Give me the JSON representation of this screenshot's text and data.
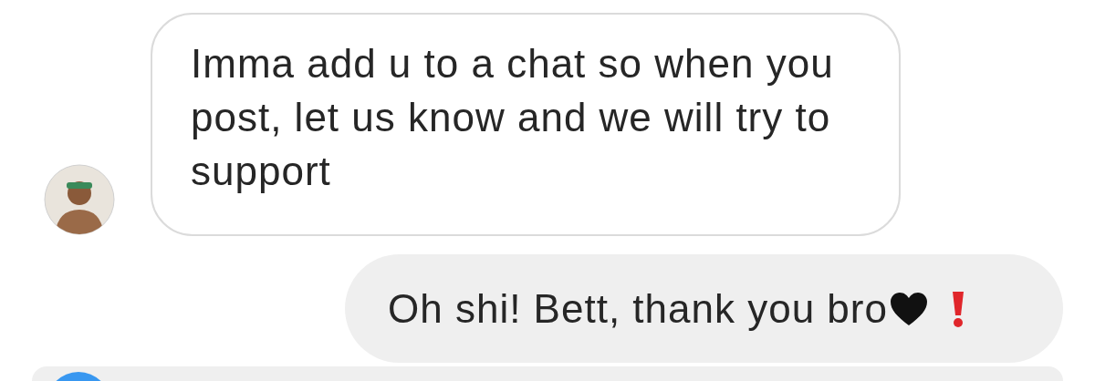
{
  "messages": [
    {
      "kind": "received",
      "text": "Imma add u to a chat so when you post, let us know and we will try to support",
      "show_avatar": true
    },
    {
      "kind": "sent",
      "text": "Oh shi! Bett, thank you bro",
      "failed": true
    },
    {
      "kind": "cut_off"
    }
  ]
}
